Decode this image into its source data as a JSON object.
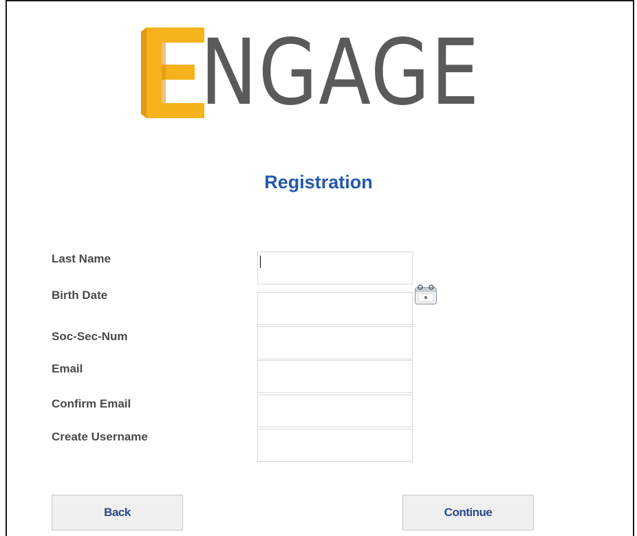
{
  "logo": {
    "text": "NGAGE",
    "accent_color": "#f5b21a",
    "text_color": "#5a5a5a"
  },
  "page": {
    "title": "Registration",
    "title_color": "#2358b0"
  },
  "form": {
    "fields": [
      {
        "label": "Last Name",
        "value": ""
      },
      {
        "label": "Birth Date",
        "value": ""
      },
      {
        "label": "Soc-Sec-Num",
        "value": ""
      },
      {
        "label": "Email",
        "value": ""
      },
      {
        "label": "Confirm Email",
        "value": ""
      },
      {
        "label": "Create Username",
        "value": ""
      }
    ],
    "calendar_icon": "calendar-icon"
  },
  "buttons": {
    "back_label": "Back",
    "continue_label": "Continue"
  }
}
